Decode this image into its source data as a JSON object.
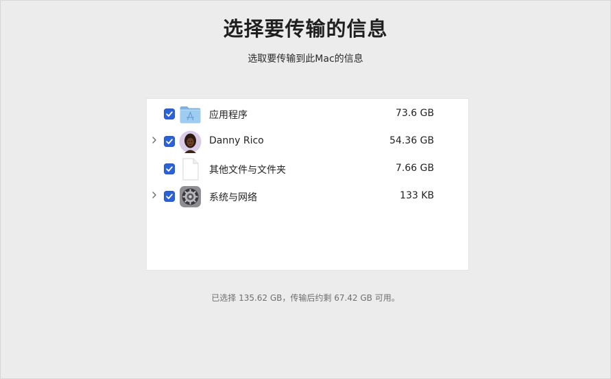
{
  "header": {
    "title": "选择要传输的信息",
    "subtitle": "选取要传输到此Mac的信息"
  },
  "items": [
    {
      "label": "应用程序",
      "size": "73.6 GB",
      "checked": true,
      "expandable": false,
      "icon": "applications-folder-icon"
    },
    {
      "label": "Danny Rico",
      "size": "54.36 GB",
      "checked": true,
      "expandable": true,
      "icon": "user-avatar-icon"
    },
    {
      "label": "其他文件与文件夹",
      "size": "7.66 GB",
      "checked": true,
      "expandable": false,
      "icon": "document-icon"
    },
    {
      "label": "系统与网络",
      "size": "133 KB",
      "checked": true,
      "expandable": true,
      "icon": "system-preferences-icon"
    }
  ],
  "footer": {
    "summary": "已选择 135.62 GB，传输后约剩 67.42 GB 可用。"
  },
  "colors": {
    "checkbox": "#2c63d4",
    "background": "#ececec",
    "panel": "#ffffff"
  }
}
